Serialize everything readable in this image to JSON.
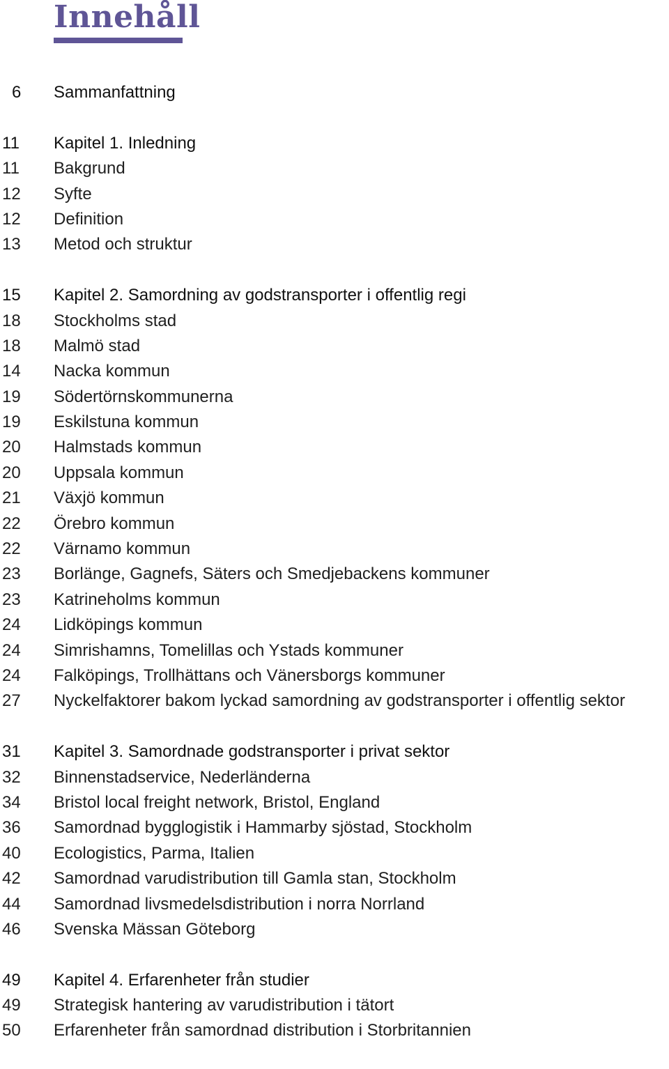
{
  "page": {
    "title": "Innehåll",
    "accent_color": "#5f5596"
  },
  "toc": {
    "groups": [
      {
        "entries": [
          {
            "page": "6",
            "label": "Sammanfattning",
            "chapter": true
          }
        ]
      },
      {
        "entries": [
          {
            "page": "11",
            "label": "Kapitel 1. Inledning",
            "chapter": true
          },
          {
            "page": "11",
            "label": "Bakgrund"
          },
          {
            "page": "12",
            "label": "Syfte"
          },
          {
            "page": "12",
            "label": "Definition"
          },
          {
            "page": "13",
            "label": "Metod och struktur"
          }
        ]
      },
      {
        "entries": [
          {
            "page": "15",
            "label": "Kapitel 2. Samordning av godstransporter i offentlig regi",
            "chapter": true
          },
          {
            "page": "18",
            "label": "Stockholms stad"
          },
          {
            "page": "18",
            "label": "Malmö stad"
          },
          {
            "page": "14",
            "label": "Nacka kommun"
          },
          {
            "page": "19",
            "label": "Södertörnskommunerna"
          },
          {
            "page": "19",
            "label": "Eskilstuna kommun"
          },
          {
            "page": "20",
            "label": "Halmstads kommun"
          },
          {
            "page": "20",
            "label": "Uppsala kommun"
          },
          {
            "page": "21",
            "label": "Växjö kommun"
          },
          {
            "page": "22",
            "label": "Örebro kommun"
          },
          {
            "page": "22",
            "label": "Värnamo kommun"
          },
          {
            "page": "23",
            "label": "Borlänge, Gagnefs, Säters och Smedjebackens kommuner"
          },
          {
            "page": "23",
            "label": "Katrineholms kommun"
          },
          {
            "page": "24",
            "label": "Lidköpings kommun"
          },
          {
            "page": "24",
            "label": "Simrishamns, Tomelillas och Ystads kommuner"
          },
          {
            "page": "24",
            "label": "Falköpings, Trollhättans och Vänersborgs kommuner"
          },
          {
            "page": "27",
            "label": "Nyckelfaktorer bakom lyckad samordning av godstransporter i offentlig sektor"
          }
        ]
      },
      {
        "entries": [
          {
            "page": "31",
            "label": "Kapitel 3. Samordnade godstransporter i privat sektor",
            "chapter": true
          },
          {
            "page": "32",
            "label": "Binnenstadservice, Nederländerna"
          },
          {
            "page": "34",
            "label": "Bristol local freight network, Bristol, England"
          },
          {
            "page": "36",
            "label": "Samordnad bygglogistik i Hammarby sjöstad, Stockholm"
          },
          {
            "page": "40",
            "label": "Ecologistics, Parma, Italien"
          },
          {
            "page": "42",
            "label": "Samordnad varudistribution till Gamla stan, Stockholm"
          },
          {
            "page": "44",
            "label": "Samordnad livsmedelsdistribution i norra Norrland"
          },
          {
            "page": "46",
            "label": "Svenska Mässan Göteborg"
          }
        ]
      },
      {
        "entries": [
          {
            "page": "49",
            "label": "Kapitel 4. Erfarenheter från studier",
            "chapter": true
          },
          {
            "page": "49",
            "label": "Strategisk hantering av varudistribution i tätort"
          },
          {
            "page": "50",
            "label": "Erfarenheter från samordnad distribution i Storbritannien"
          }
        ]
      }
    ]
  }
}
